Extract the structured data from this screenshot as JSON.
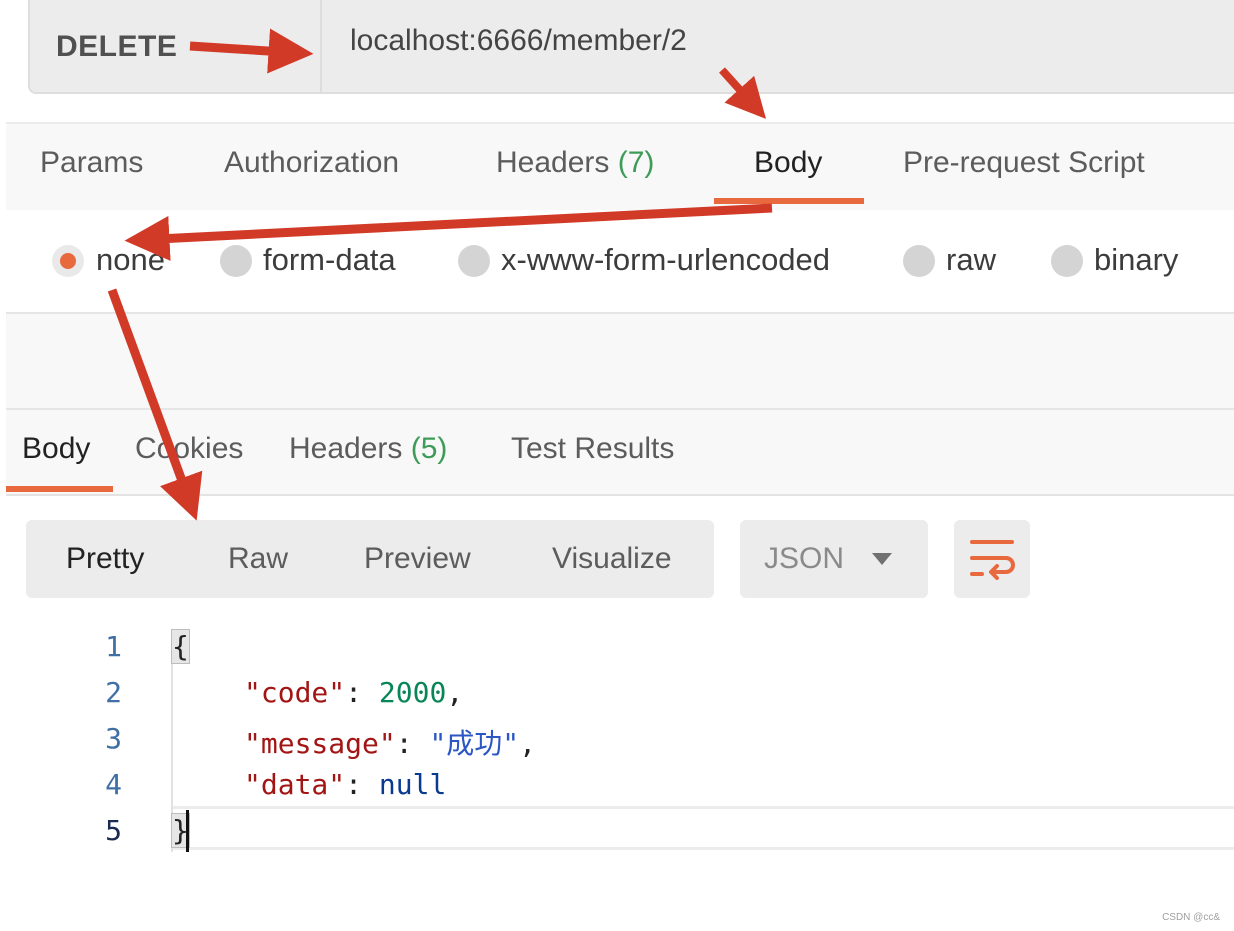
{
  "request": {
    "method": "DELETE",
    "url": "localhost:6666/member/2"
  },
  "request_tabs": {
    "params": "Params",
    "authorization": "Authorization",
    "headers": "Headers",
    "headers_count": "(7)",
    "body": "Body",
    "pre_request": "Pre-request Script",
    "active": "Body"
  },
  "body_types": {
    "selected": "none",
    "none": "none",
    "form_data": "form-data",
    "urlencoded": "x-www-form-urlencoded",
    "raw": "raw",
    "binary": "binary"
  },
  "response_tabs": {
    "body": "Body",
    "cookies": "Cookies",
    "headers": "Headers",
    "headers_count": "(5)",
    "test_results": "Test Results",
    "active": "Body"
  },
  "view_modes": {
    "pretty": "Pretty",
    "raw": "Raw",
    "preview": "Preview",
    "visualize": "Visualize",
    "active": "Pretty"
  },
  "format": {
    "selected": "JSON"
  },
  "code": {
    "line_numbers": [
      "1",
      "2",
      "3",
      "4",
      "5"
    ],
    "open_brace": "{",
    "close_brace": "}",
    "code_key": "\"code\"",
    "code_value": "2000",
    "message_key": "\"message\"",
    "message_value": "\"成功\"",
    "data_key": "\"data\"",
    "data_value": "null",
    "colon": ": ",
    "comma": ","
  },
  "watermark": "CSDN @cc&",
  "colors": {
    "accent": "#e8693e",
    "annotation_arrow": "#d23a28",
    "count_green": "#3e9b58"
  },
  "icons": {
    "dropdown": "caret-down-icon",
    "wrap": "wrap-lines-icon",
    "radio": "radio-button-icon"
  }
}
